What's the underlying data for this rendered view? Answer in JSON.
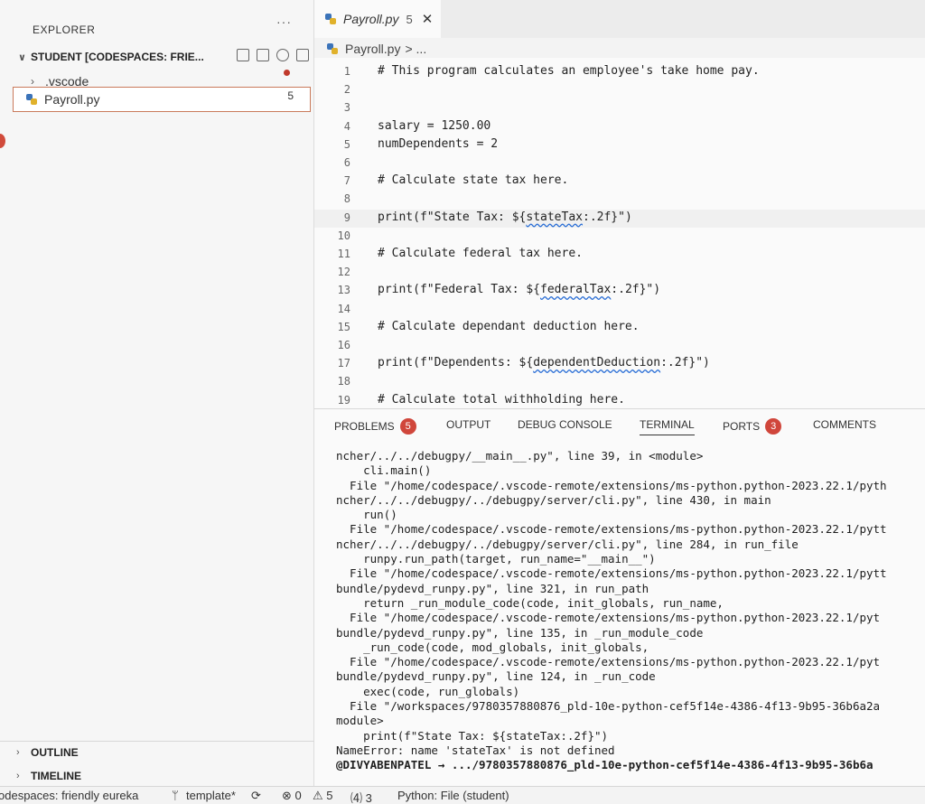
{
  "sidebar": {
    "title": "EXPLORER",
    "more": "···",
    "workspace": "STUDENT [CODESPACES: FRIE...",
    "tree": {
      "vscode": ".vscode",
      "payroll": "Payroll.py",
      "payroll_badge": "5"
    },
    "outline": "OUTLINE",
    "timeline": "TIMELINE"
  },
  "tab": {
    "label": "Payroll.py",
    "modified": "5",
    "close": "✕"
  },
  "breadcrumb": {
    "file": "Payroll.py",
    "rest": "> ..."
  },
  "editor": {
    "lines": [
      {
        "n": "1",
        "t": "# This program calculates an employee's take home pay."
      },
      {
        "n": "2",
        "t": ""
      },
      {
        "n": "3",
        "t": ""
      },
      {
        "n": "4",
        "t": "salary = 1250.00"
      },
      {
        "n": "5",
        "t": "numDependents = 2"
      },
      {
        "n": "6",
        "t": ""
      },
      {
        "n": "7",
        "t": "# Calculate state tax here."
      },
      {
        "n": "8",
        "t": ""
      },
      {
        "n": "9",
        "a": "print(f\"State Tax: ${",
        "s": "stateTax",
        "b": ":.2f}\")"
      },
      {
        "n": "10",
        "t": ""
      },
      {
        "n": "11",
        "t": "# Calculate federal tax here."
      },
      {
        "n": "12",
        "t": ""
      },
      {
        "n": "13",
        "a": "print(f\"Federal Tax: ${",
        "s": "federalTax",
        "b": ":.2f}\")"
      },
      {
        "n": "14",
        "t": ""
      },
      {
        "n": "15",
        "t": "# Calculate dependant deduction here."
      },
      {
        "n": "16",
        "t": ""
      },
      {
        "n": "17",
        "a": "print(f\"Dependents: ${",
        "s": "dependentDeduction",
        "b": ":.2f}\")"
      },
      {
        "n": "18",
        "t": ""
      },
      {
        "n": "19",
        "t": "# Calculate total withholding here."
      }
    ]
  },
  "panel": {
    "tabs": {
      "problems": "PROBLEMS",
      "problems_count": "5",
      "output": "OUTPUT",
      "debug": "DEBUG CONSOLE",
      "terminal": "TERMINAL",
      "ports": "PORTS",
      "ports_count": "3",
      "comments": "COMMENTS"
    },
    "terminal_lines": [
      "ncher/../../debugpy/__main__.py\", line 39, in <module>",
      "    cli.main()",
      "  File \"/home/codespace/.vscode-remote/extensions/ms-python.python-2023.22.1/pyth",
      "ncher/../../debugpy/../debugpy/server/cli.py\", line 430, in main",
      "    run()",
      "  File \"/home/codespace/.vscode-remote/extensions/ms-python.python-2023.22.1/pytt",
      "ncher/../../debugpy/../debugpy/server/cli.py\", line 284, in run_file",
      "    runpy.run_path(target, run_name=\"__main__\")",
      "  File \"/home/codespace/.vscode-remote/extensions/ms-python.python-2023.22.1/pytt",
      "bundle/pydevd_runpy.py\", line 321, in run_path",
      "    return _run_module_code(code, init_globals, run_name,",
      "  File \"/home/codespace/.vscode-remote/extensions/ms-python.python-2023.22.1/pyt",
      "bundle/pydevd_runpy.py\", line 135, in _run_module_code",
      "    _run_code(code, mod_globals, init_globals,",
      "  File \"/home/codespace/.vscode-remote/extensions/ms-python.python-2023.22.1/pyt",
      "bundle/pydevd_runpy.py\", line 124, in _run_code",
      "    exec(code, run_globals)",
      "  File \"/workspaces/9780357880876_pld-10e-python-cef5f14e-4386-4f13-9b95-36b6a2a",
      "module>",
      "    print(f\"State Tax: ${stateTax:.2f}\")",
      "NameError: name 'stateTax' is not defined"
    ],
    "prompt": "@DIVYABENPATEL → .../9780357880876_pld-10e-python-cef5f14e-4386-4f13-9b95-36b6a"
  },
  "statusbar": {
    "codespace": "odespaces: friendly eureka",
    "branch": "template*",
    "sync": "⟳",
    "errors": "⊗ 0",
    "warnings": "⚠ 5",
    "ports": "⑷ 3",
    "python": "Python: File (student)"
  }
}
